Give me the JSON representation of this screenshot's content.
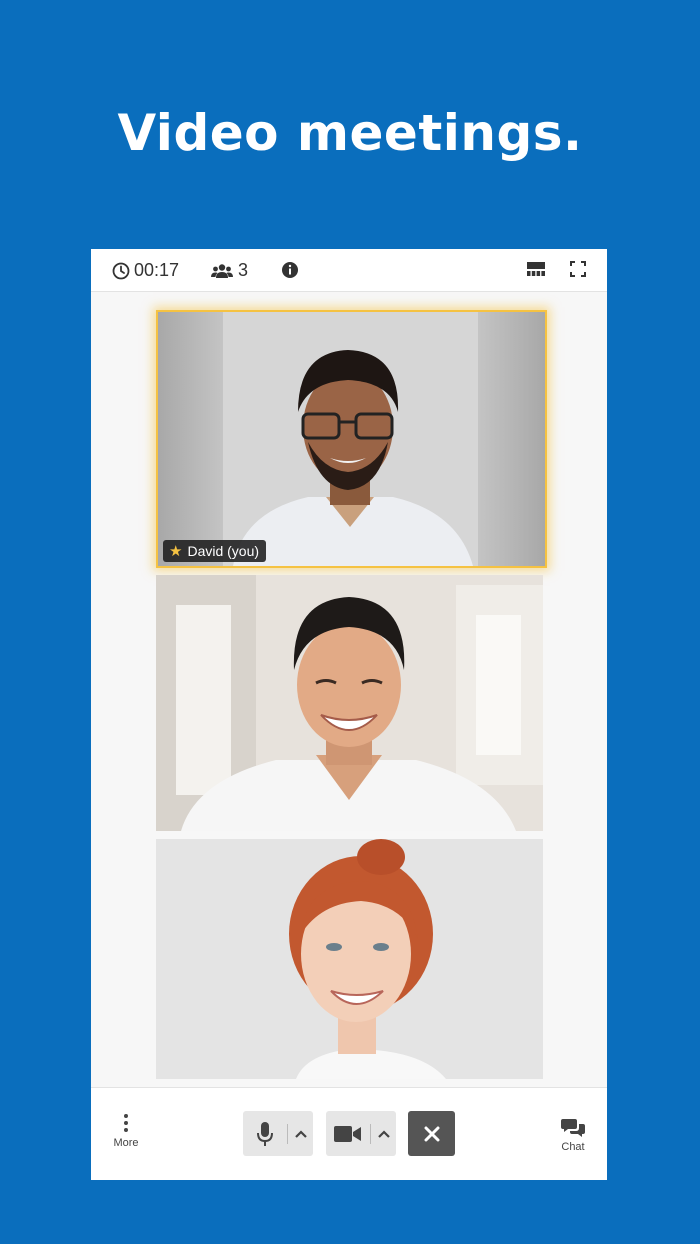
{
  "headline": "Video meetings.",
  "topbar": {
    "timer": "00:17",
    "participant_count": "3"
  },
  "tiles": [
    {
      "name_tag": "David (you)",
      "highlighted": true
    },
    {
      "name_tag": ""
    },
    {
      "name_tag": ""
    }
  ],
  "bottombar": {
    "more_label": "More",
    "chat_label": "Chat"
  },
  "colors": {
    "background": "#0a6ebd",
    "active_speaker_border": "#f5c242",
    "hangup": "#555555"
  },
  "icons": {
    "timer": "clock-icon",
    "participants": "people-icon",
    "info": "info-icon",
    "layout": "tile-layout-icon",
    "fullscreen": "fullscreen-icon",
    "more": "vertical-dots-icon",
    "mic": "microphone-icon",
    "camera": "video-camera-icon",
    "hangup": "close-icon",
    "chat": "chat-bubbles-icon"
  }
}
